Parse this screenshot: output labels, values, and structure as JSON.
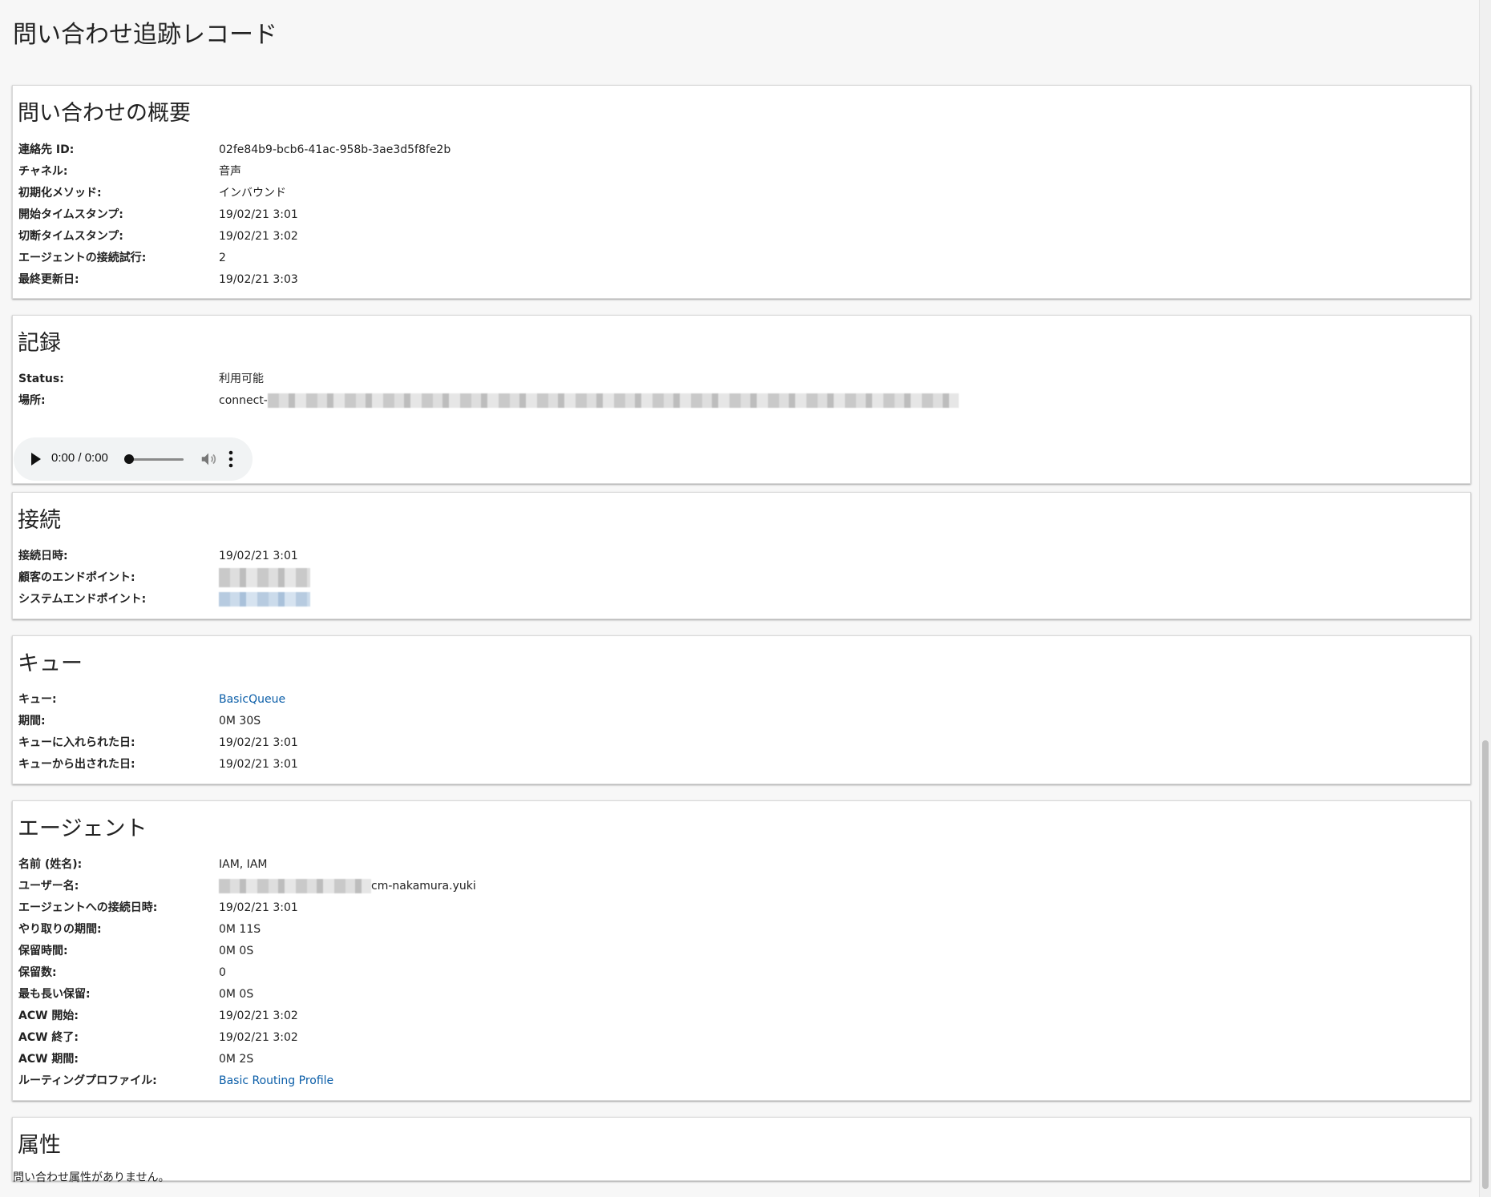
{
  "page": {
    "title": "問い合わせ追跡レコード"
  },
  "summary": {
    "heading": "問い合わせの概要",
    "rows": [
      {
        "label": "連絡先 ID:",
        "value": "02fe84b9-bcb6-41ac-958b-3ae3d5f8fe2b"
      },
      {
        "label": "チャネル:",
        "value": "音声"
      },
      {
        "label": "初期化メソッド:",
        "value": "インバウンド"
      },
      {
        "label": "開始タイムスタンプ:",
        "value": "19/02/21 3:01"
      },
      {
        "label": "切断タイムスタンプ:",
        "value": "19/02/21 3:02"
      },
      {
        "label": "エージェントの接続試行:",
        "value": "2"
      },
      {
        "label": "最終更新日:",
        "value": "19/02/21 3:03"
      }
    ]
  },
  "recording": {
    "heading": "記録",
    "status_label": "Status:",
    "status_value": "利用可能",
    "location_label": "場所:",
    "location_prefix": "connect-",
    "player": {
      "time": "0:00 / 0:00",
      "play_icon": "play-icon",
      "volume_icon": "volume-icon",
      "more_icon": "more-vertical-icon"
    }
  },
  "connection": {
    "heading": "接続",
    "connected_label": "接続日時:",
    "connected_value": "19/02/21 3:01",
    "customer_endpoint_label": "顧客のエンドポイント:",
    "system_endpoint_label": "システムエンドポイント:"
  },
  "queue": {
    "heading": "キュー",
    "queue_label": "キュー:",
    "queue_value": "BasicQueue",
    "rows": [
      {
        "label": "期間:",
        "value": "0M 30S"
      },
      {
        "label": "キューに入れられた日:",
        "value": "19/02/21 3:01"
      },
      {
        "label": "キューから出された日:",
        "value": "19/02/21 3:01"
      }
    ]
  },
  "agent": {
    "heading": "エージェント",
    "name_label": "名前 (姓名):",
    "name_value": "IAM, IAM",
    "username_label": "ユーザー名:",
    "username_suffix": "cm-nakamura.yuki",
    "rows": [
      {
        "label": "エージェントへの接続日時:",
        "value": "19/02/21 3:01"
      },
      {
        "label": "やり取りの期間:",
        "value": "0M 11S"
      },
      {
        "label": "保留時間:",
        "value": "0M 0S"
      },
      {
        "label": "保留数:",
        "value": "0"
      },
      {
        "label": "最も長い保留:",
        "value": "0M 0S"
      },
      {
        "label": "ACW 開始:",
        "value": "19/02/21 3:02"
      },
      {
        "label": "ACW 終了:",
        "value": "19/02/21 3:02"
      },
      {
        "label": "ACW 期間:",
        "value": "0M 2S"
      }
    ],
    "routing_label": "ルーティングプロファイル:",
    "routing_value": "Basic Routing Profile"
  },
  "attributes": {
    "heading": "属性",
    "empty_text": "問い合わせ属性がありません。"
  },
  "colors": {
    "link": "#0b5ea8",
    "background": "#f7f7f7",
    "card": "#ffffff"
  }
}
